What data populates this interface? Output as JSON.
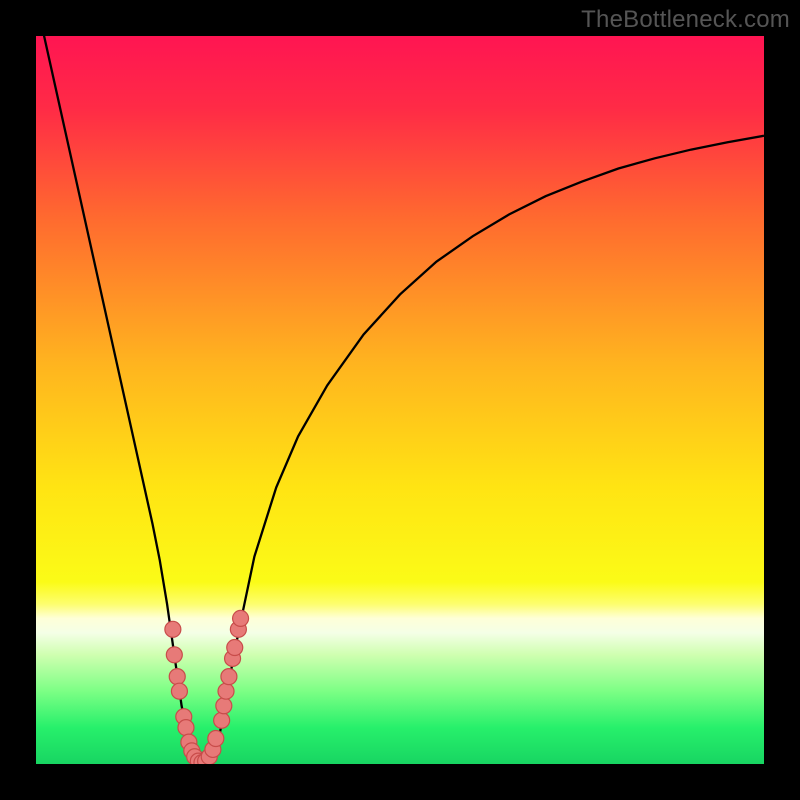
{
  "watermark": "TheBottleneck.com",
  "gradient": {
    "stops": [
      {
        "offset": 0.0,
        "color": "#ff1552"
      },
      {
        "offset": 0.1,
        "color": "#ff2b46"
      },
      {
        "offset": 0.25,
        "color": "#ff6a2f"
      },
      {
        "offset": 0.45,
        "color": "#ffb41f"
      },
      {
        "offset": 0.62,
        "color": "#ffe413"
      },
      {
        "offset": 0.75,
        "color": "#fbfb17"
      },
      {
        "offset": 0.78,
        "color": "#fdfe6d"
      },
      {
        "offset": 0.8,
        "color": "#feffd8"
      },
      {
        "offset": 0.82,
        "color": "#f4ffe6"
      },
      {
        "offset": 0.85,
        "color": "#cfffb0"
      },
      {
        "offset": 0.9,
        "color": "#7cff85"
      },
      {
        "offset": 0.95,
        "color": "#27f06b"
      },
      {
        "offset": 1.0,
        "color": "#18d562"
      }
    ]
  },
  "chart_data": {
    "type": "line",
    "title": "",
    "xlabel": "",
    "ylabel": "",
    "xlim": [
      0,
      100
    ],
    "ylim": [
      0,
      100
    ],
    "series": [
      {
        "name": "bottleneck-curve",
        "x": [
          0.0,
          2.0,
          4.0,
          6.0,
          8.0,
          10.0,
          12.0,
          14.0,
          16.0,
          17.0,
          18.0,
          19.0,
          20.0,
          21.0,
          22.0,
          23.0,
          24.0,
          25.0,
          26.0,
          27.0,
          28.0,
          30.0,
          33.0,
          36.0,
          40.0,
          45.0,
          50.0,
          55.0,
          60.0,
          65.0,
          70.0,
          75.0,
          80.0,
          85.0,
          90.0,
          95.0,
          100.0
        ],
        "y": [
          105.0,
          96.0,
          87.0,
          78.0,
          69.0,
          60.0,
          51.0,
          42.0,
          33.0,
          28.0,
          22.0,
          15.0,
          8.0,
          3.0,
          0.5,
          0.0,
          0.5,
          3.0,
          8.0,
          14.0,
          19.0,
          28.5,
          38.0,
          45.0,
          52.0,
          59.0,
          64.5,
          69.0,
          72.5,
          75.5,
          78.0,
          80.0,
          81.8,
          83.2,
          84.4,
          85.4,
          86.3
        ]
      }
    ],
    "markers": [
      {
        "x": 18.8,
        "y": 18.5
      },
      {
        "x": 19.0,
        "y": 15.0
      },
      {
        "x": 19.4,
        "y": 12.0
      },
      {
        "x": 19.7,
        "y": 10.0
      },
      {
        "x": 20.3,
        "y": 6.5
      },
      {
        "x": 20.6,
        "y": 5.0
      },
      {
        "x": 21.0,
        "y": 3.0
      },
      {
        "x": 21.4,
        "y": 1.8
      },
      {
        "x": 21.8,
        "y": 1.0
      },
      {
        "x": 22.3,
        "y": 0.4
      },
      {
        "x": 22.8,
        "y": 0.2
      },
      {
        "x": 23.3,
        "y": 0.4
      },
      {
        "x": 23.8,
        "y": 1.0
      },
      {
        "x": 24.3,
        "y": 2.0
      },
      {
        "x": 24.7,
        "y": 3.5
      },
      {
        "x": 25.5,
        "y": 6.0
      },
      {
        "x": 25.8,
        "y": 8.0
      },
      {
        "x": 26.1,
        "y": 10.0
      },
      {
        "x": 26.5,
        "y": 12.0
      },
      {
        "x": 27.0,
        "y": 14.5
      },
      {
        "x": 27.3,
        "y": 16.0
      },
      {
        "x": 27.8,
        "y": 18.5
      },
      {
        "x": 28.1,
        "y": 20.0
      }
    ],
    "marker_style": {
      "fill": "#e77a78",
      "stroke": "#c84c4a",
      "r": 8
    },
    "line_style": {
      "stroke": "#000000",
      "width": 2.3
    }
  }
}
